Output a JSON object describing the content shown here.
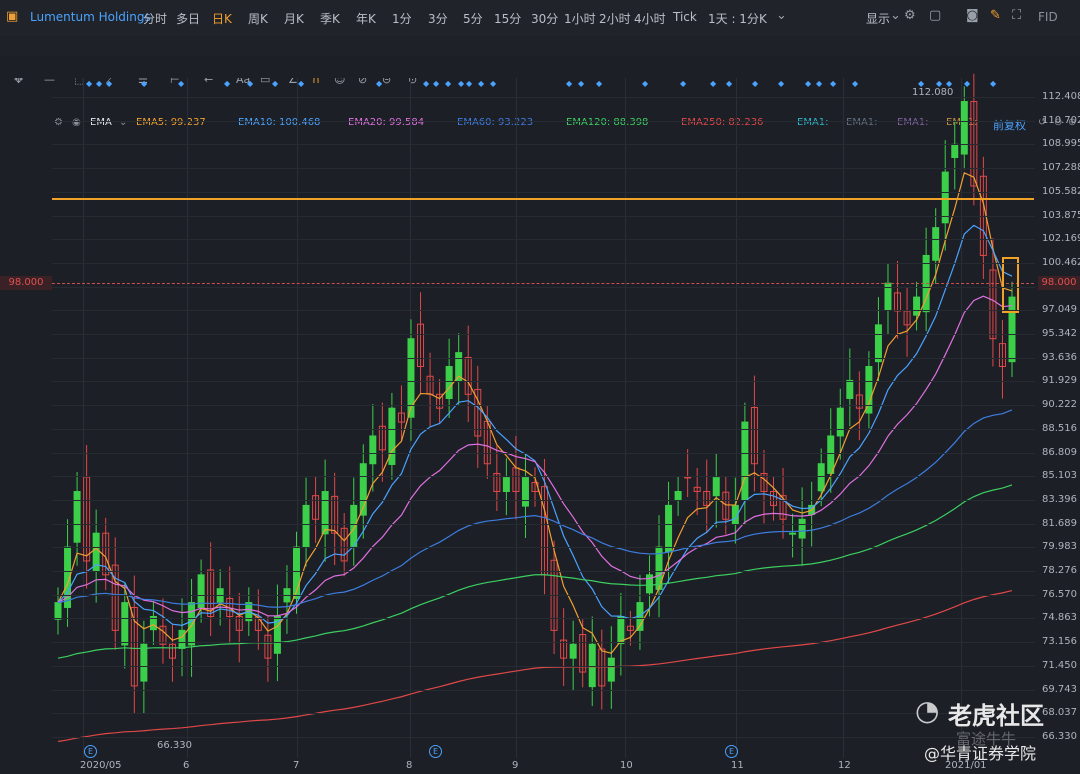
{
  "app": {
    "name": "Lumentum Holdings"
  },
  "periods": [
    "分时",
    "多日",
    "日K",
    "周K",
    "月K",
    "季K",
    "年K",
    "1分",
    "3分",
    "5分",
    "15分",
    "30分",
    "1小时",
    "2小时",
    "4小时",
    "Tick",
    "1天 : 1分K"
  ],
  "active_period": "日K",
  "right_menu": {
    "display": "显示",
    "label_fid": "FID"
  },
  "tools": [
    "✥",
    "—",
    "⬚",
    "⟋",
    "☰",
    "⊢",
    "←",
    "Aa",
    "▭",
    "∠",
    "∩",
    "☺",
    "⊘",
    "⊝",
    "⊙"
  ],
  "indicator_bar": {
    "name": "EMA",
    "items": [
      {
        "label": "EMA5: 99.237",
        "color": "#f0a030"
      },
      {
        "label": "EMA10: 100.468",
        "color": "#4aa3ff"
      },
      {
        "label": "EMA20: 99.584",
        "color": "#e070e0"
      },
      {
        "label": "EMA60: 93.223",
        "color": "#3d7de0"
      },
      {
        "label": "EMA120: 88.398",
        "color": "#3ccf60"
      },
      {
        "label": "EMA250: 82.236",
        "color": "#e04848"
      },
      {
        "label": "EMA1:",
        "color": "#2bb5c8"
      },
      {
        "label": "EMA1:",
        "color": "#607080"
      },
      {
        "label": "EMA1:",
        "color": "#8060a0"
      },
      {
        "label": "EMA1:",
        "color": "#c09040"
      }
    ],
    "adjust": "前复权"
  },
  "y_ticks": [
    "112.408",
    "110.702",
    "108.995",
    "107.288",
    "105.582",
    "103.875",
    "102.169",
    "100.462",
    "98.000",
    "97.049",
    "95.342",
    "93.636",
    "91.929",
    "90.222",
    "88.516",
    "86.809",
    "85.103",
    "83.396",
    "81.689",
    "79.983",
    "78.276",
    "76.570",
    "74.863",
    "73.156",
    "71.450",
    "69.743",
    "68.037",
    "66.330"
  ],
  "x_ticks": [
    "2020/05",
    "6",
    "7",
    "8",
    "9",
    "10",
    "11",
    "12",
    "2021/01"
  ],
  "current_price": "98.000",
  "annotations": {
    "high": "112.080",
    "low": "66.330",
    "earnings_badge": "E"
  },
  "watermark": {
    "brand": "老虎社区",
    "sub": "@华青证券学院",
    "ghost": "富途牛牛"
  },
  "chart_data": {
    "type": "candlestick",
    "title": "Lumentum Holdings",
    "period": "日K",
    "x_range": [
      "2020/05",
      "2021/01"
    ],
    "ylim": [
      66.33,
      112.408
    ],
    "grid": true,
    "horizontal_levels": [
      {
        "name": "resistance",
        "value": 105.0,
        "color": "#f0a326"
      },
      {
        "name": "current",
        "value": 98.0,
        "color": "#c85050",
        "style": "dashed"
      }
    ],
    "close_series": [
      {
        "date": "2020/05",
        "close": 76
      },
      {
        "date": "2020/05",
        "close": 80
      },
      {
        "date": "2020/05",
        "close": 84
      },
      {
        "date": "2020/05",
        "close": 79
      },
      {
        "date": "2020/05",
        "close": 81
      },
      {
        "date": "2020/05",
        "close": 78
      },
      {
        "date": "2020/05",
        "close": 74
      },
      {
        "date": "2020/05",
        "close": 76
      },
      {
        "date": "2020/05",
        "close": 70
      },
      {
        "date": "2020/05",
        "close": 73
      },
      {
        "date": "6",
        "close": 75
      },
      {
        "date": "6",
        "close": 73
      },
      {
        "date": "6",
        "close": 72
      },
      {
        "date": "6",
        "close": 74
      },
      {
        "date": "6",
        "close": 76
      },
      {
        "date": "6",
        "close": 78
      },
      {
        "date": "6",
        "close": 75
      },
      {
        "date": "6",
        "close": 77
      },
      {
        "date": "6",
        "close": 75
      },
      {
        "date": "6",
        "close": 74
      },
      {
        "date": "6",
        "close": 76
      },
      {
        "date": "6",
        "close": 74
      },
      {
        "date": "6",
        "close": 72
      },
      {
        "date": "6",
        "close": 75
      },
      {
        "date": "6",
        "close": 77
      },
      {
        "date": "7",
        "close": 80
      },
      {
        "date": "7",
        "close": 83
      },
      {
        "date": "7",
        "close": 82
      },
      {
        "date": "7",
        "close": 84
      },
      {
        "date": "7",
        "close": 81
      },
      {
        "date": "7",
        "close": 79
      },
      {
        "date": "7",
        "close": 83
      },
      {
        "date": "7",
        "close": 86
      },
      {
        "date": "7",
        "close": 88
      },
      {
        "date": "7",
        "close": 87
      },
      {
        "date": "7",
        "close": 90
      },
      {
        "date": "7",
        "close": 89
      },
      {
        "date": "8",
        "close": 95
      },
      {
        "date": "8",
        "close": 93
      },
      {
        "date": "8",
        "close": 91
      },
      {
        "date": "8",
        "close": 90
      },
      {
        "date": "8",
        "close": 93
      },
      {
        "date": "8",
        "close": 94
      },
      {
        "date": "8",
        "close": 91
      },
      {
        "date": "8",
        "close": 88
      },
      {
        "date": "8",
        "close": 86
      },
      {
        "date": "8",
        "close": 84
      },
      {
        "date": "8",
        "close": 85
      },
      {
        "date": "8",
        "close": 84
      },
      {
        "date": "8",
        "close": 85
      },
      {
        "date": "9",
        "close": 84
      },
      {
        "date": "9",
        "close": 78
      },
      {
        "date": "9",
        "close": 74
      },
      {
        "date": "9",
        "close": 72
      },
      {
        "date": "9",
        "close": 73
      },
      {
        "date": "9",
        "close": 71
      },
      {
        "date": "9",
        "close": 73
      },
      {
        "date": "9",
        "close": 70
      },
      {
        "date": "9",
        "close": 72
      },
      {
        "date": "9",
        "close": 75
      },
      {
        "date": "9",
        "close": 74
      },
      {
        "date": "10",
        "close": 76
      },
      {
        "date": "10",
        "close": 78
      },
      {
        "date": "10",
        "close": 80
      },
      {
        "date": "10",
        "close": 83
      },
      {
        "date": "10",
        "close": 84
      },
      {
        "date": "10",
        "close": 85
      },
      {
        "date": "10",
        "close": 84
      },
      {
        "date": "10",
        "close": 83
      },
      {
        "date": "10",
        "close": 85
      },
      {
        "date": "10",
        "close": 82
      },
      {
        "date": "10",
        "close": 83
      },
      {
        "date": "11",
        "close": 89
      },
      {
        "date": "11",
        "close": 86
      },
      {
        "date": "11",
        "close": 84
      },
      {
        "date": "11",
        "close": 83
      },
      {
        "date": "11",
        "close": 82
      },
      {
        "date": "11",
        "close": 81
      },
      {
        "date": "11",
        "close": 82
      },
      {
        "date": "11",
        "close": 83
      },
      {
        "date": "11",
        "close": 86
      },
      {
        "date": "11",
        "close": 88
      },
      {
        "date": "11",
        "close": 90
      },
      {
        "date": "12",
        "close": 92
      },
      {
        "date": "12",
        "close": 90
      },
      {
        "date": "12",
        "close": 93
      },
      {
        "date": "12",
        "close": 96
      },
      {
        "date": "12",
        "close": 99
      },
      {
        "date": "12",
        "close": 97
      },
      {
        "date": "12",
        "close": 96
      },
      {
        "date": "12",
        "close": 98
      },
      {
        "date": "12",
        "close": 101
      },
      {
        "date": "12",
        "close": 103
      },
      {
        "date": "2021/01",
        "close": 107
      },
      {
        "date": "2021/01",
        "close": 109
      },
      {
        "date": "2021/01",
        "close": 112.08
      },
      {
        "date": "2021/01",
        "close": 106
      },
      {
        "date": "2021/01",
        "close": 101
      },
      {
        "date": "2021/01",
        "close": 95
      },
      {
        "date": "2021/01",
        "close": 93
      },
      {
        "date": "2021/01",
        "close": 98
      }
    ],
    "ema_series": [
      {
        "name": "EMA5",
        "last": 99.237,
        "color": "#f0a030"
      },
      {
        "name": "EMA10",
        "last": 100.468,
        "color": "#4aa3ff"
      },
      {
        "name": "EMA20",
        "last": 99.584,
        "color": "#e070e0"
      },
      {
        "name": "EMA60",
        "last": 93.223,
        "color": "#3d7de0"
      },
      {
        "name": "EMA120",
        "last": 88.398,
        "color": "#3ccf60"
      },
      {
        "name": "EMA250",
        "last": 82.236,
        "color": "#e04848"
      }
    ]
  }
}
